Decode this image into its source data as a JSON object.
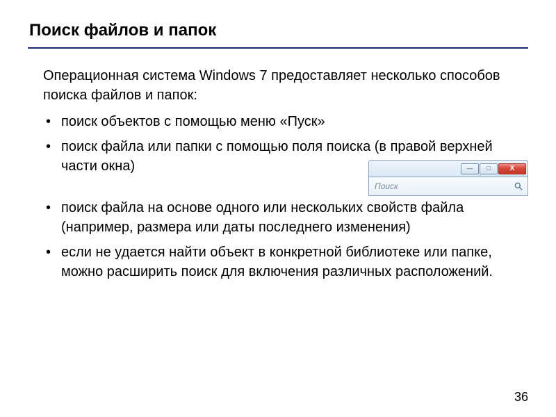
{
  "title": "Поиск файлов и папок",
  "intro": "Операционная система Windows 7 предоставляет несколько способов поиска файлов и папок:",
  "bullets_top": [
    "поиск объектов с помощью меню «Пуск»",
    "поиск файла или папки с помощью поля поиска (в правой верхней части окна)"
  ],
  "bullets_bottom": [
    "поиск файла на основе одного или нескольких свойств файла (например, размера или даты последнего изменения)",
    "если не удается найти объект в конкретной библиотеке или папке, можно расширить поиск для включения различных расположений."
  ],
  "window": {
    "min_glyph": "—",
    "max_glyph": "□",
    "close_glyph": "X",
    "search_placeholder": "Поиск"
  },
  "page_number": "36"
}
